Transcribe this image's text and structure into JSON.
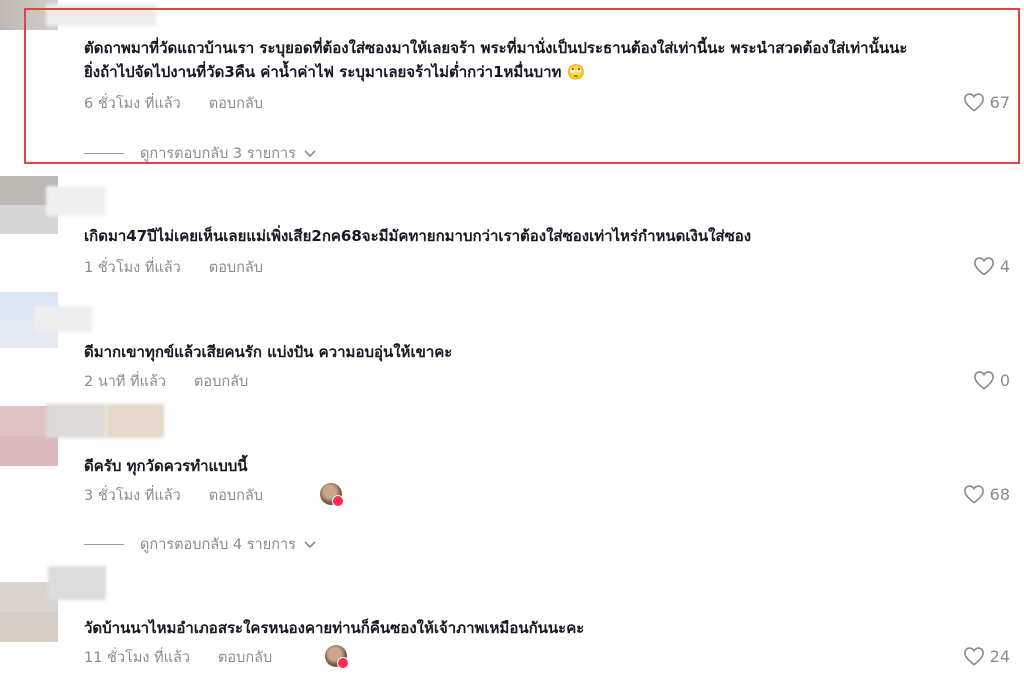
{
  "comments": [
    {
      "text_line1": "ตัดถาพมาที่วัดแถวบ้านเรา ระบุยอดที่ต้องใส่ซองมาให้เลยจร้า พระที่มานั่งเป็นประธานต้องใส่เท่านี้นะ พระนำสวดต้องใส่เท่านั้นนะ",
      "text_line2": "ยิ่งถ้าไปจัดไปงานที่วัด3คืน ค่าน้ำค่าไฟ ระบุมาเลยจร้าไม่ต่ำกว่า1หมื่นบาท 🙄",
      "time": "6 ชั่วโมง ที่แล้ว",
      "reply": "ตอบกลับ",
      "likes": "67",
      "view_replies": "ดูการตอบกลับ 3 รายการ"
    },
    {
      "text": "เกิดมา47ปีไม่เคยเห็นเลยแม่เพิ่งเสีย2กค68จะมีมัคทายกมาบกว่าเราต้องใส่ซองเท่าไหร่กำหนดเงินใส่ซอง",
      "time": "1 ชั่วโมง ที่แล้ว",
      "reply": "ตอบกลับ",
      "likes": "4"
    },
    {
      "text": "ดีมากเขาทุกข์แล้วเสียคนรัก แบ่งปัน ความอบอุ่นให้เขาคะ",
      "time": "2 นาที ที่แล้ว",
      "reply": "ตอบกลับ",
      "likes": "0"
    },
    {
      "text": "ดีครับ ทุกวัดควรทำแบบนี้",
      "time": "3 ชั่วโมง ที่แล้ว",
      "reply": "ตอบกลับ",
      "likes": "68",
      "view_replies": "ดูการตอบกลับ 4 รายการ"
    },
    {
      "text": "วัดบ้านนาไหมอำเภอสระใครหนองคายท่านก็คืนซองให้เจ้าภาพเหมือนกันนะคะ",
      "time": "11 ชั่วโมง ที่แล้ว",
      "reply": "ตอบกลับ",
      "likes": "24"
    }
  ],
  "colors": {
    "highlight": "#e04545",
    "text": "#161823",
    "muted": "#8a8b91",
    "badge": "#fe2c55"
  },
  "icons": [
    "heart-outline-icon",
    "chevron-down-icon",
    "creator-avatar-icon"
  ]
}
